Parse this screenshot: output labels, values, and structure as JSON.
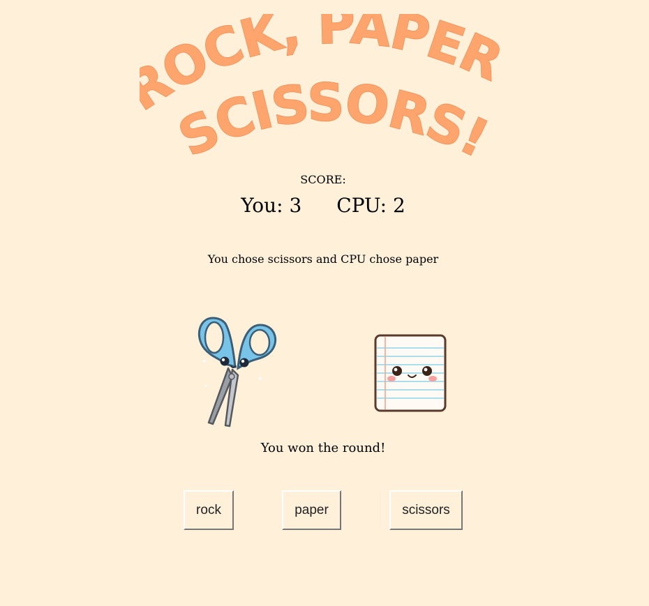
{
  "header": {
    "title_line1": "ROCK, PAPER,",
    "title_line2": "SCISSORS!"
  },
  "score": {
    "label": "SCORE:",
    "you": "You: 3",
    "cpu": "CPU: 2"
  },
  "round": {
    "message": "You chose scissors and CPU chose paper",
    "player_choice_icon": "scissors-icon",
    "cpu_choice_icon": "paper-icon",
    "result": "You won the round!"
  },
  "controls": {
    "rock_label": "rock",
    "paper_label": "paper",
    "scissors_label": "scissors"
  },
  "colors": {
    "background": "#fff0da",
    "title": "#fda56c",
    "scissors_handle": "#78c3e8",
    "paper_lines": "#8fd3e8"
  }
}
